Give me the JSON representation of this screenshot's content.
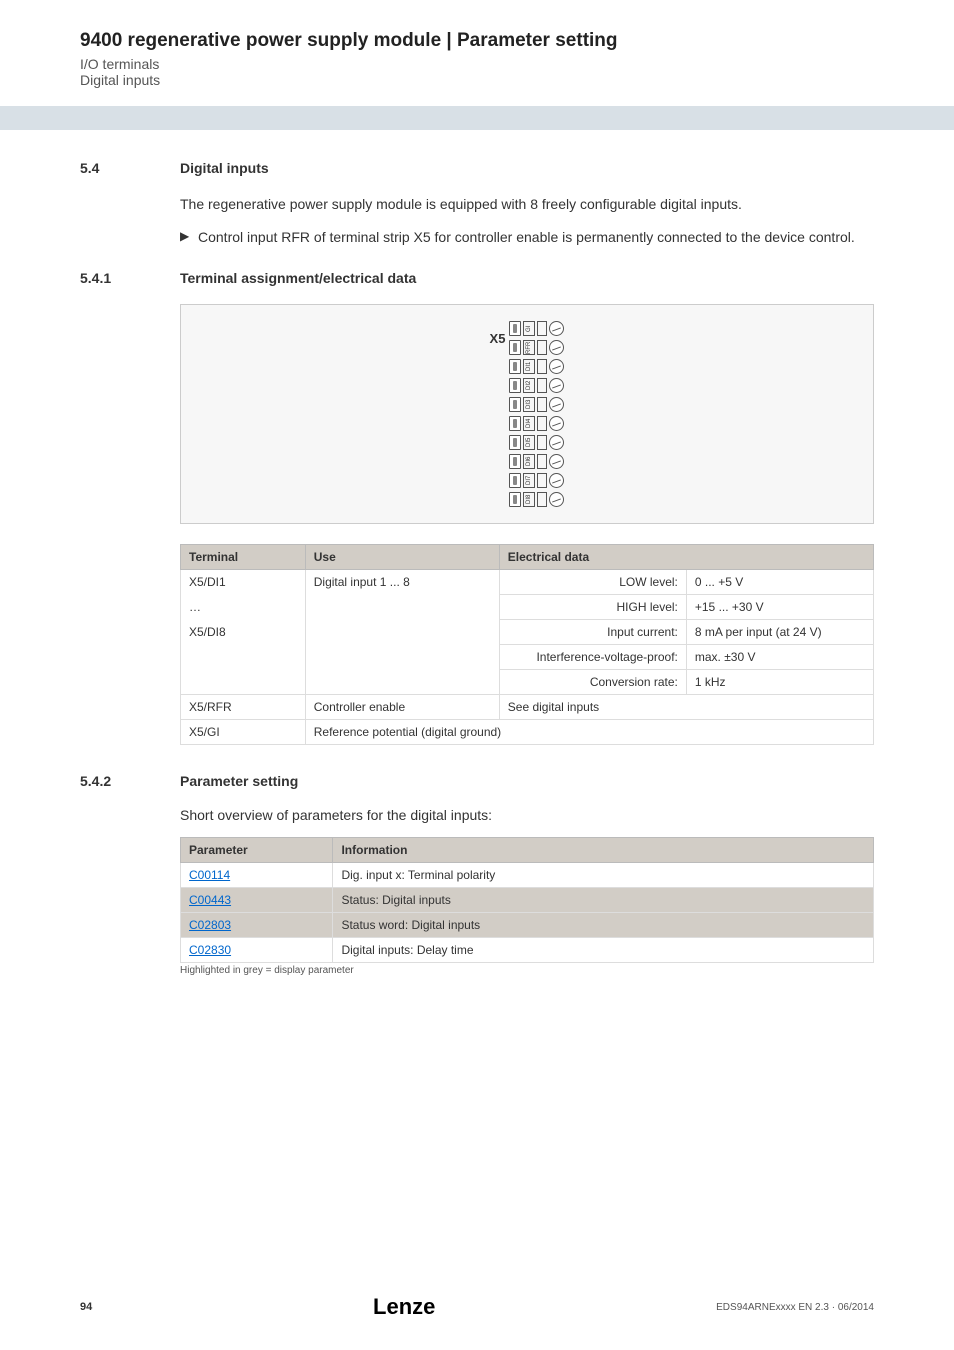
{
  "header": {
    "title": "9400 regenerative power supply module | Parameter setting",
    "sub1": "I/O terminals",
    "sub2": "Digital inputs"
  },
  "sec54": {
    "num": "5.4",
    "title": "Digital inputs",
    "para": "The regenerative power supply module is equipped with 8 freely configurable digital inputs.",
    "bullet": "Control input RFR of terminal strip X5 for controller enable is permanently connected to the device control."
  },
  "sec541": {
    "num": "5.4.1",
    "title": "Terminal assignment/electrical data",
    "x5_label": "X5",
    "pins": [
      "GI",
      "RFR",
      "DI1",
      "DI2",
      "DI3",
      "DI4",
      "DI5",
      "DI6",
      "DI7",
      "DI8"
    ],
    "tbl": {
      "h1": "Terminal",
      "h2": "Use",
      "h3": "Electrical data",
      "r1c1": "X5/DI1",
      "r1c1b": "…",
      "r1c1c": "X5/DI8",
      "r1c2": "Digital input 1 ... 8",
      "low_l": "LOW level:",
      "low_v": "0 ... +5 V",
      "high_l": "HIGH level:",
      "high_v": "+15 ... +30 V",
      "ic_l": "Input current:",
      "ic_v": "8 mA per input (at 24 V)",
      "iv_l": "Interference-voltage-proof:",
      "iv_v": "max. ±30 V",
      "cr_l": "Conversion rate:",
      "cr_v": "1 kHz",
      "r2c1": "X5/RFR",
      "r2c2": "Controller enable",
      "r2c3": "See digital inputs",
      "r3c1": "X5/GI",
      "r3c2": "Reference potential (digital ground)"
    }
  },
  "sec542": {
    "num": "5.4.2",
    "title": "Parameter setting",
    "intro": "Short overview of parameters for the digital inputs:",
    "tbl": {
      "h1": "Parameter",
      "h2": "Information",
      "r1p": "C00114",
      "r1i": "Dig. input x: Terminal polarity",
      "r2p": "C00443",
      "r2i": "Status: Digital inputs",
      "r3p": "C02803",
      "r3i": "Status word: Digital inputs",
      "r4p": "C02830",
      "r4i": "Digital inputs: Delay time"
    },
    "footnote": "Highlighted in grey = display parameter"
  },
  "footer": {
    "page": "94",
    "logo": "Lenze",
    "docid": "EDS94ARNExxxx EN 2.3 · 06/2014"
  }
}
